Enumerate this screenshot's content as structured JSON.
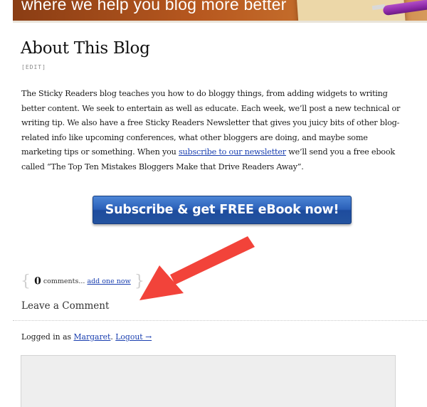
{
  "header": {
    "tagline": "where we help you blog more better"
  },
  "post": {
    "title": "About This Blog",
    "edit_label": "[EDIT]",
    "body_before_link": "The Sticky Readers blog teaches you how to do bloggy things, from adding widgets to writing better content. We seek to entertain as well as educate. Each week, we’ll post a new technical or writing tip. We also have a free Sticky Readers Newsletter that gives you juicy bits of other blog-related info like upcoming conferences, what other bloggers are doing, and maybe some marketing tips or something. When you ",
    "body_link": "subscribe to our newsletter",
    "body_after_link": " we’ll send you a free ebook called “The Top Ten Mistakes Bloggers Make that Drive Readers Away”."
  },
  "subscribe": {
    "button_label": "Subscribe & get FREE eBook now!"
  },
  "comments": {
    "brace_open": "{",
    "count": "0",
    "count_text": " comments... ",
    "add_link": "add one now",
    "brace_close": "}",
    "leave_heading": "Leave a Comment",
    "logged_in_prefix": "Logged in as ",
    "username": "Margaret",
    "separator": ". ",
    "logout_label": "Logout →",
    "textarea_value": ""
  },
  "colors": {
    "link": "#1a3fb0",
    "button_blue": "#2a5fb8",
    "arrow_red": "#f2433a",
    "header_orange": "#b7581f"
  },
  "icons": {
    "arrow": "annotation-arrow-icon"
  }
}
